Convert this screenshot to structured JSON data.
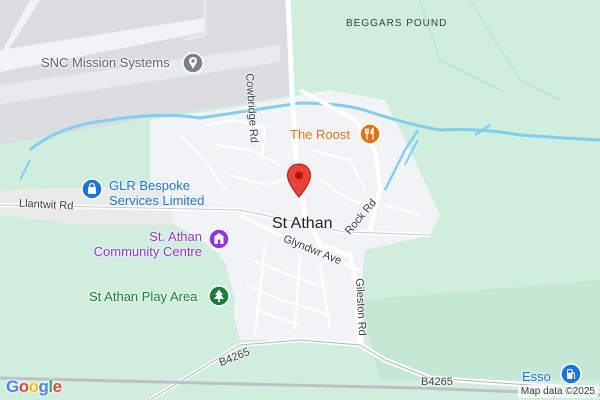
{
  "map": {
    "places": {
      "beggars_pound": "BEGGARS POUND",
      "st_athan": "St Athan"
    },
    "pois": {
      "snc": "SNC Mission Systems",
      "glr_line1": "GLR Bespoke",
      "glr_line2": "Services Limited",
      "community_line1": "St. Athan",
      "community_line2": "Community Centre",
      "roost": "The Roost",
      "play_area": "St Athan Play Area",
      "esso": "Esso"
    },
    "roads": {
      "cowbridge": "Cowbridge Rd",
      "llantwit": "Llantwit Rd",
      "rock": "Rock Rd",
      "glyndwr": "Glyndwr Ave",
      "gileston": "Gileston Rd",
      "b4265_left": "B4265",
      "b4265_right": "B4265"
    },
    "branding": {
      "google": [
        "G",
        "o",
        "o",
        "g",
        "l",
        "e"
      ],
      "google_colors": [
        "#4285F4",
        "#EA4335",
        "#FBBC05",
        "#4285F4",
        "#34A853",
        "#EA4335"
      ],
      "attribution": "Map data ©2025"
    },
    "colors": {
      "park_green": "#cfeedd",
      "urban": "#f1f3f4",
      "airfield": "#dadce0",
      "water": "#7fd0f0",
      "pin": "#ea4335"
    },
    "icons": {
      "pin": "location-pin-icon",
      "snc": "business-icon",
      "glr": "shopping-bag-icon",
      "community": "community-building-icon",
      "roost": "restaurant-icon",
      "play": "tree-park-icon",
      "esso": "gas-station-icon"
    }
  }
}
